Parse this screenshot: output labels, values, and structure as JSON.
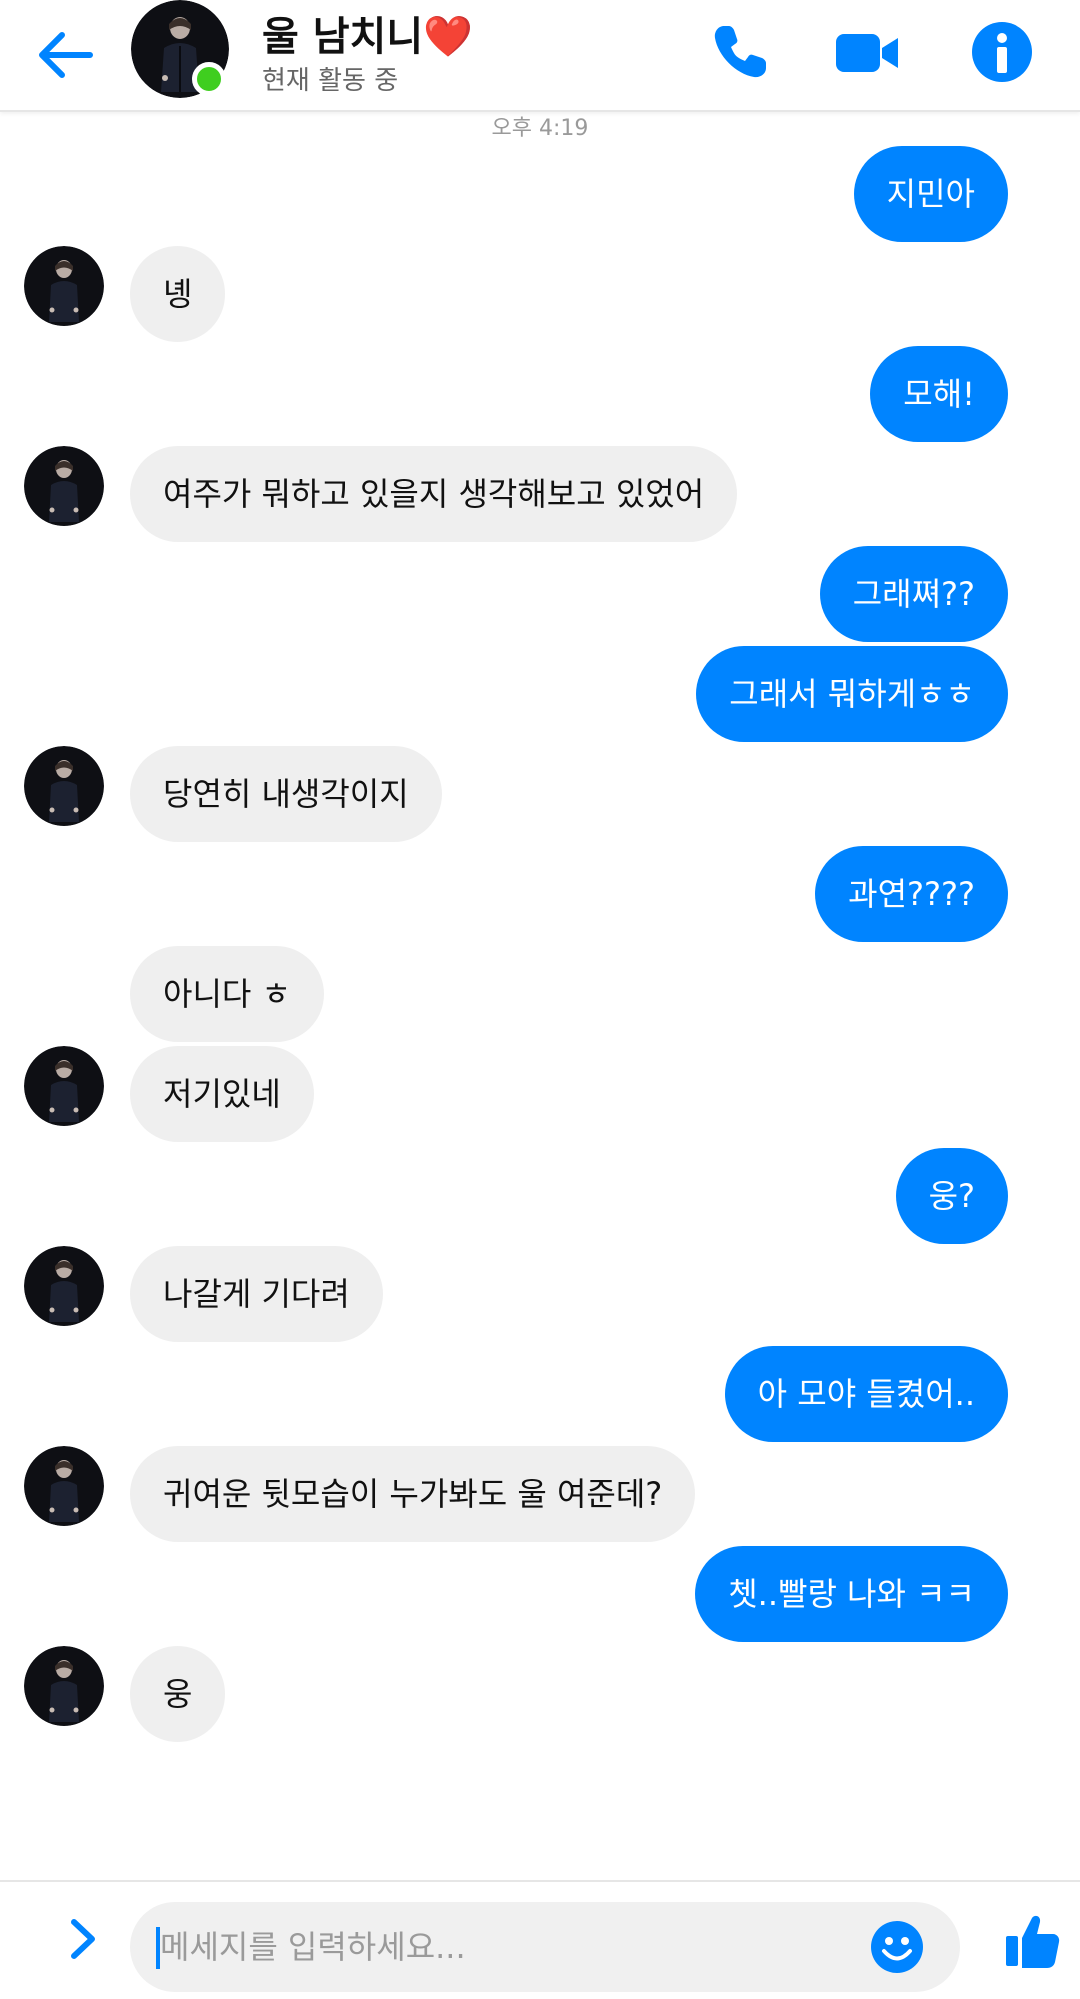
{
  "header": {
    "name": "울 남치니❤️",
    "status": "현재 활동 중"
  },
  "timestamp": "오후 4:19",
  "messages": [
    {
      "dir": "out",
      "text": "지민아"
    },
    {
      "dir": "in",
      "text": "녱"
    },
    {
      "dir": "out",
      "text": "모해!"
    },
    {
      "dir": "in",
      "text": "여주가 뭐하고 있을지 생각해보고 있었어"
    },
    {
      "dir": "out",
      "text": "그래쪄??"
    },
    {
      "dir": "out",
      "text": "그래서 뭐하게ㅎㅎ"
    },
    {
      "dir": "in",
      "text": "당연히 내생각이지"
    },
    {
      "dir": "out",
      "text": "과연????"
    },
    {
      "dir": "in",
      "text": "아니다 ㅎ"
    },
    {
      "dir": "in",
      "text": "저기있네"
    },
    {
      "dir": "out",
      "text": "웅?"
    },
    {
      "dir": "in",
      "text": "나갈게 기다려"
    },
    {
      "dir": "out",
      "text": "아 모야 들켰어.."
    },
    {
      "dir": "in",
      "text": "귀여운 뒷모습이 누가봐도 울 여준데?"
    },
    {
      "dir": "out",
      "text": "쳇..빨랑 나와 ㅋㅋ"
    },
    {
      "dir": "in",
      "text": "웅"
    }
  ],
  "composer": {
    "placeholder": "메세지를 입력하세요..."
  },
  "colors": {
    "accent": "#0084ff",
    "incoming_bubble": "#efefef",
    "online": "#3fce1f"
  },
  "icons": [
    "back-arrow-icon",
    "phone-icon",
    "video-camera-icon",
    "info-icon",
    "chevron-right-icon",
    "smiley-icon",
    "thumbs-up-icon"
  ]
}
